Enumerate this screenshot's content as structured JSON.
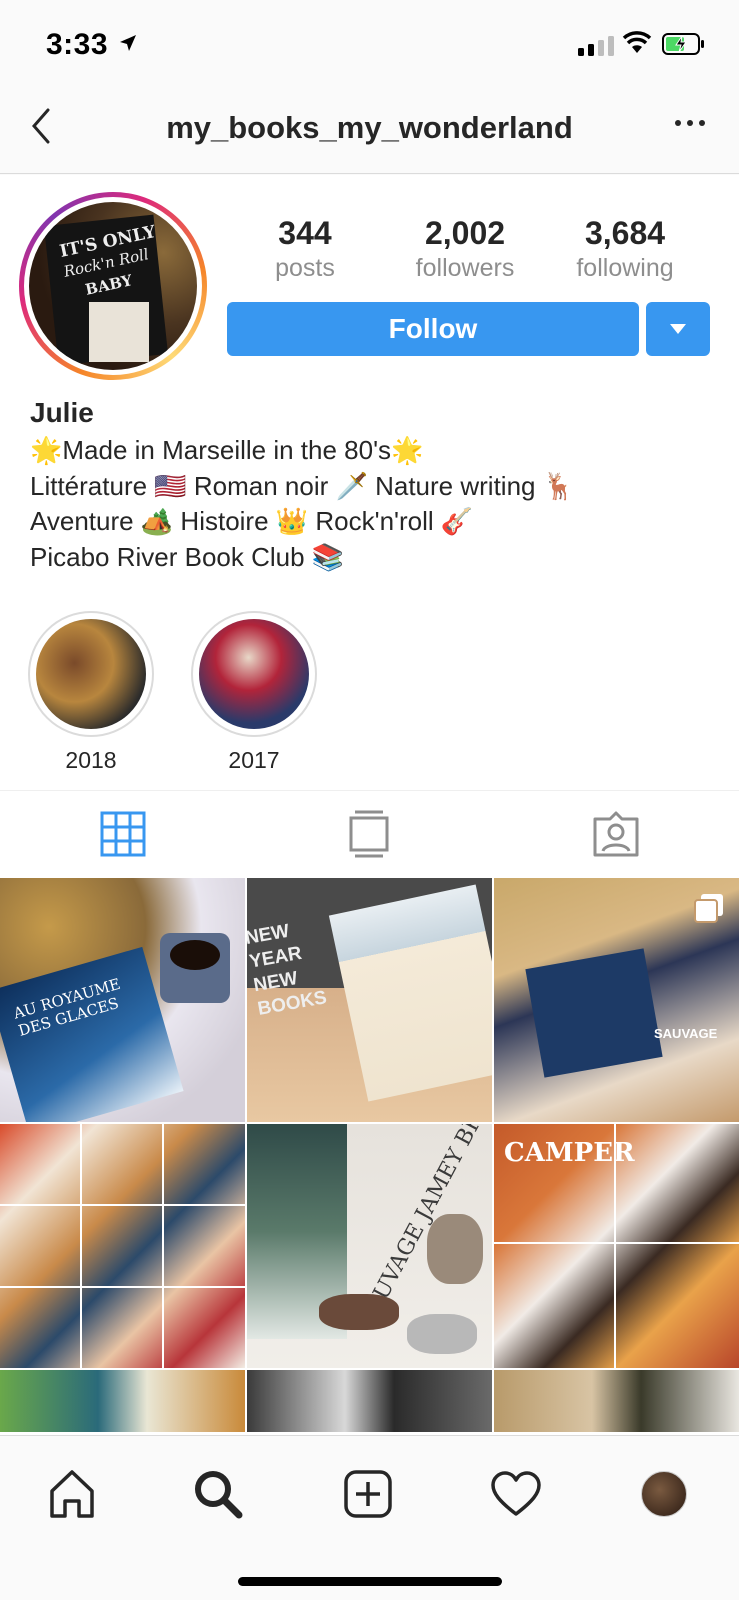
{
  "status_bar": {
    "time": "3:33"
  },
  "header": {
    "username": "my_books_my_wonderland"
  },
  "avatar": {
    "lines": [
      "IT'S ONLY",
      "Rock'n Roll",
      "BABY"
    ]
  },
  "stats": [
    {
      "value": "344",
      "label": "posts"
    },
    {
      "value": "2,002",
      "label": "followers"
    },
    {
      "value": "3,684",
      "label": "following"
    }
  ],
  "actions": {
    "follow_label": "Follow"
  },
  "bio": {
    "name": "Julie",
    "lines": [
      "🌟Made in Marseille in the 80's🌟",
      "Littérature 🇺🇸 Roman noir 🗡️ Nature writing 🦌",
      "Aventure 🏕️ Histoire 👑 Rock'n'roll 🎸",
      "Picabo River Book Club 📚"
    ]
  },
  "highlights": [
    {
      "label": "2018"
    },
    {
      "label": "2017"
    }
  ],
  "tabs": [
    {
      "icon": "grid-icon",
      "active": true
    },
    {
      "icon": "feed-icon",
      "active": false
    },
    {
      "icon": "tagged-icon",
      "active": false
    }
  ],
  "grid_posts": [
    {
      "caption": "AU ROYAUME DES GLACES",
      "type": "photo"
    },
    {
      "caption": "NEW YEAR NEW BOOKS",
      "type": "photo"
    },
    {
      "caption": "SAUVAGE",
      "type": "carousel"
    },
    {
      "caption": "",
      "type": "collage"
    },
    {
      "caption": "SAUVAGE JAMEY BRADBURY",
      "type": "photo"
    },
    {
      "caption": "CAMPER",
      "type": "collage"
    }
  ],
  "bottom_nav": [
    "home-icon",
    "search-icon",
    "new-post-icon",
    "activity-heart-icon",
    "profile-avatar"
  ],
  "colors": {
    "accent": "#3897f0",
    "text": "#262626",
    "muted": "#8e8e8e"
  }
}
